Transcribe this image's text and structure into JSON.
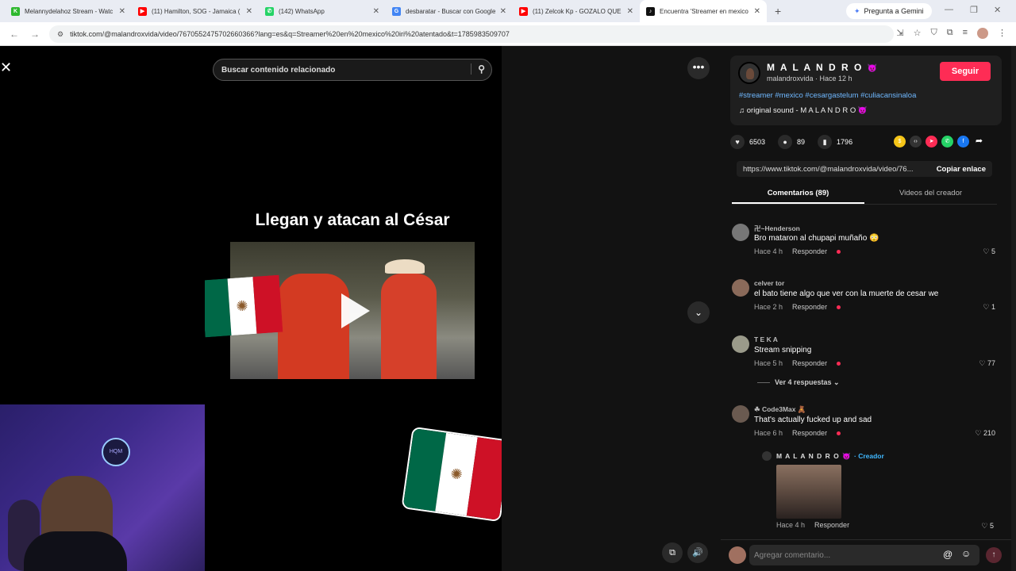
{
  "browser": {
    "tabs": [
      {
        "label": "Melannydelahoz Stream - Watc",
        "fav_color": "#2eb82e",
        "fav": "K"
      },
      {
        "label": "(11) Hamilton, SOG - Jamaica (",
        "fav_color": "#ff0000",
        "fav": "▶"
      },
      {
        "label": "(142) WhatsApp",
        "fav_color": "#25d366",
        "fav": "✆"
      },
      {
        "label": "desbaratar - Buscar con Google",
        "fav_color": "#4285f4",
        "fav": "G"
      },
      {
        "label": "(11) Zelcok Kp - GOZALO QUE",
        "fav_color": "#ff0000",
        "fav": "▶"
      },
      {
        "label": "Encuentra 'Streamer en mexico",
        "fav_color": "#111111",
        "fav": "♪"
      }
    ],
    "gemini_label": "Pregunta a Gemini",
    "url": "tiktok.com/@malandroxvida/video/7670552475702660366?lang=es&q=Streamer%20en%20mexico%20iri%20atentado&t=1785983509707"
  },
  "search": {
    "placeholder": "Buscar contenido relacionado"
  },
  "video": {
    "title": "Llegan y atacan al César"
  },
  "creator": {
    "name": "M A L A N D R O",
    "emoji": "😈",
    "handle": "malandroxvida · Hace 12 h",
    "follow_label": "Seguir",
    "tags": "#streamer #mexico #cesargastelum #culiacansinaloa",
    "sound": "♫  original sound - M A L A N D R O 😈"
  },
  "stats": {
    "likes": "6503",
    "comments": "89",
    "saves": "1796"
  },
  "link": {
    "url": "https://www.tiktok.com/@malandroxvida/video/76...",
    "copy_label": "Copiar enlace"
  },
  "tabs": {
    "comments": "Comentarios (89)",
    "videos": "Videos del creador"
  },
  "comments": [
    {
      "name": "卍~Henderson",
      "text": "Bro mataron al chupapi muñaño 😳",
      "time": "Hace 4 h",
      "reply": "Responder",
      "likes": "♡ 5"
    },
    {
      "name": "celver tor",
      "text": "el bato tiene algo que ver con la muerte de cesar we",
      "time": "Hace 2 h",
      "reply": "Responder",
      "likes": "♡ 1"
    },
    {
      "name": "T E K A",
      "text": "Stream snipping",
      "time": "Hace 5 h",
      "reply": "Responder",
      "likes": "♡ 77"
    },
    {
      "name": "☘ Code3Max 🧸",
      "text": "That's actually fucked up and sad",
      "time": "Hace 6 h",
      "reply": "Responder",
      "likes": "♡ 210"
    }
  ],
  "view_replies": "Ver 4 respuestas ⌄",
  "reply": {
    "name": "M A L A N D R O 😈",
    "creator_tag": "· Creador",
    "time": "Hace 4 h",
    "reply": "Responder",
    "likes": "♡ 5"
  },
  "input": {
    "placeholder": "Agregar comentario..."
  },
  "webcam": {
    "sign": "HQM"
  }
}
